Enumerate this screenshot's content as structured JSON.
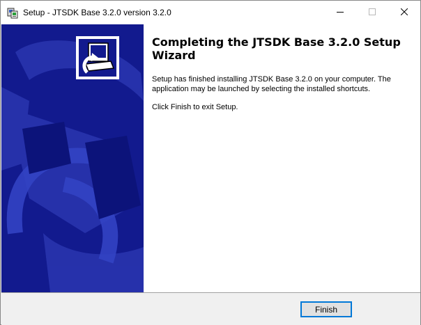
{
  "window": {
    "title": "Setup - JTSDK Base 3.2.0 version 3.2.0",
    "icon": "installer-icon",
    "controls": {
      "minimize_icon": "minimize-icon",
      "maximize_icon": "maximize-icon",
      "close_icon": "close-icon"
    }
  },
  "sidebar": {
    "background_color": "#121a8e",
    "logo_icon": "computer-install-icon"
  },
  "content": {
    "heading": "Completing the JTSDK Base 3.2.0 Setup Wizard",
    "paragraph_1": "Setup has finished installing JTSDK Base 3.2.0 on your computer. The application may be launched by selecting the installed shortcuts.",
    "paragraph_2": "Click Finish to exit Setup."
  },
  "footer": {
    "finish_label": "Finish",
    "accent_color": "#0078d7"
  }
}
